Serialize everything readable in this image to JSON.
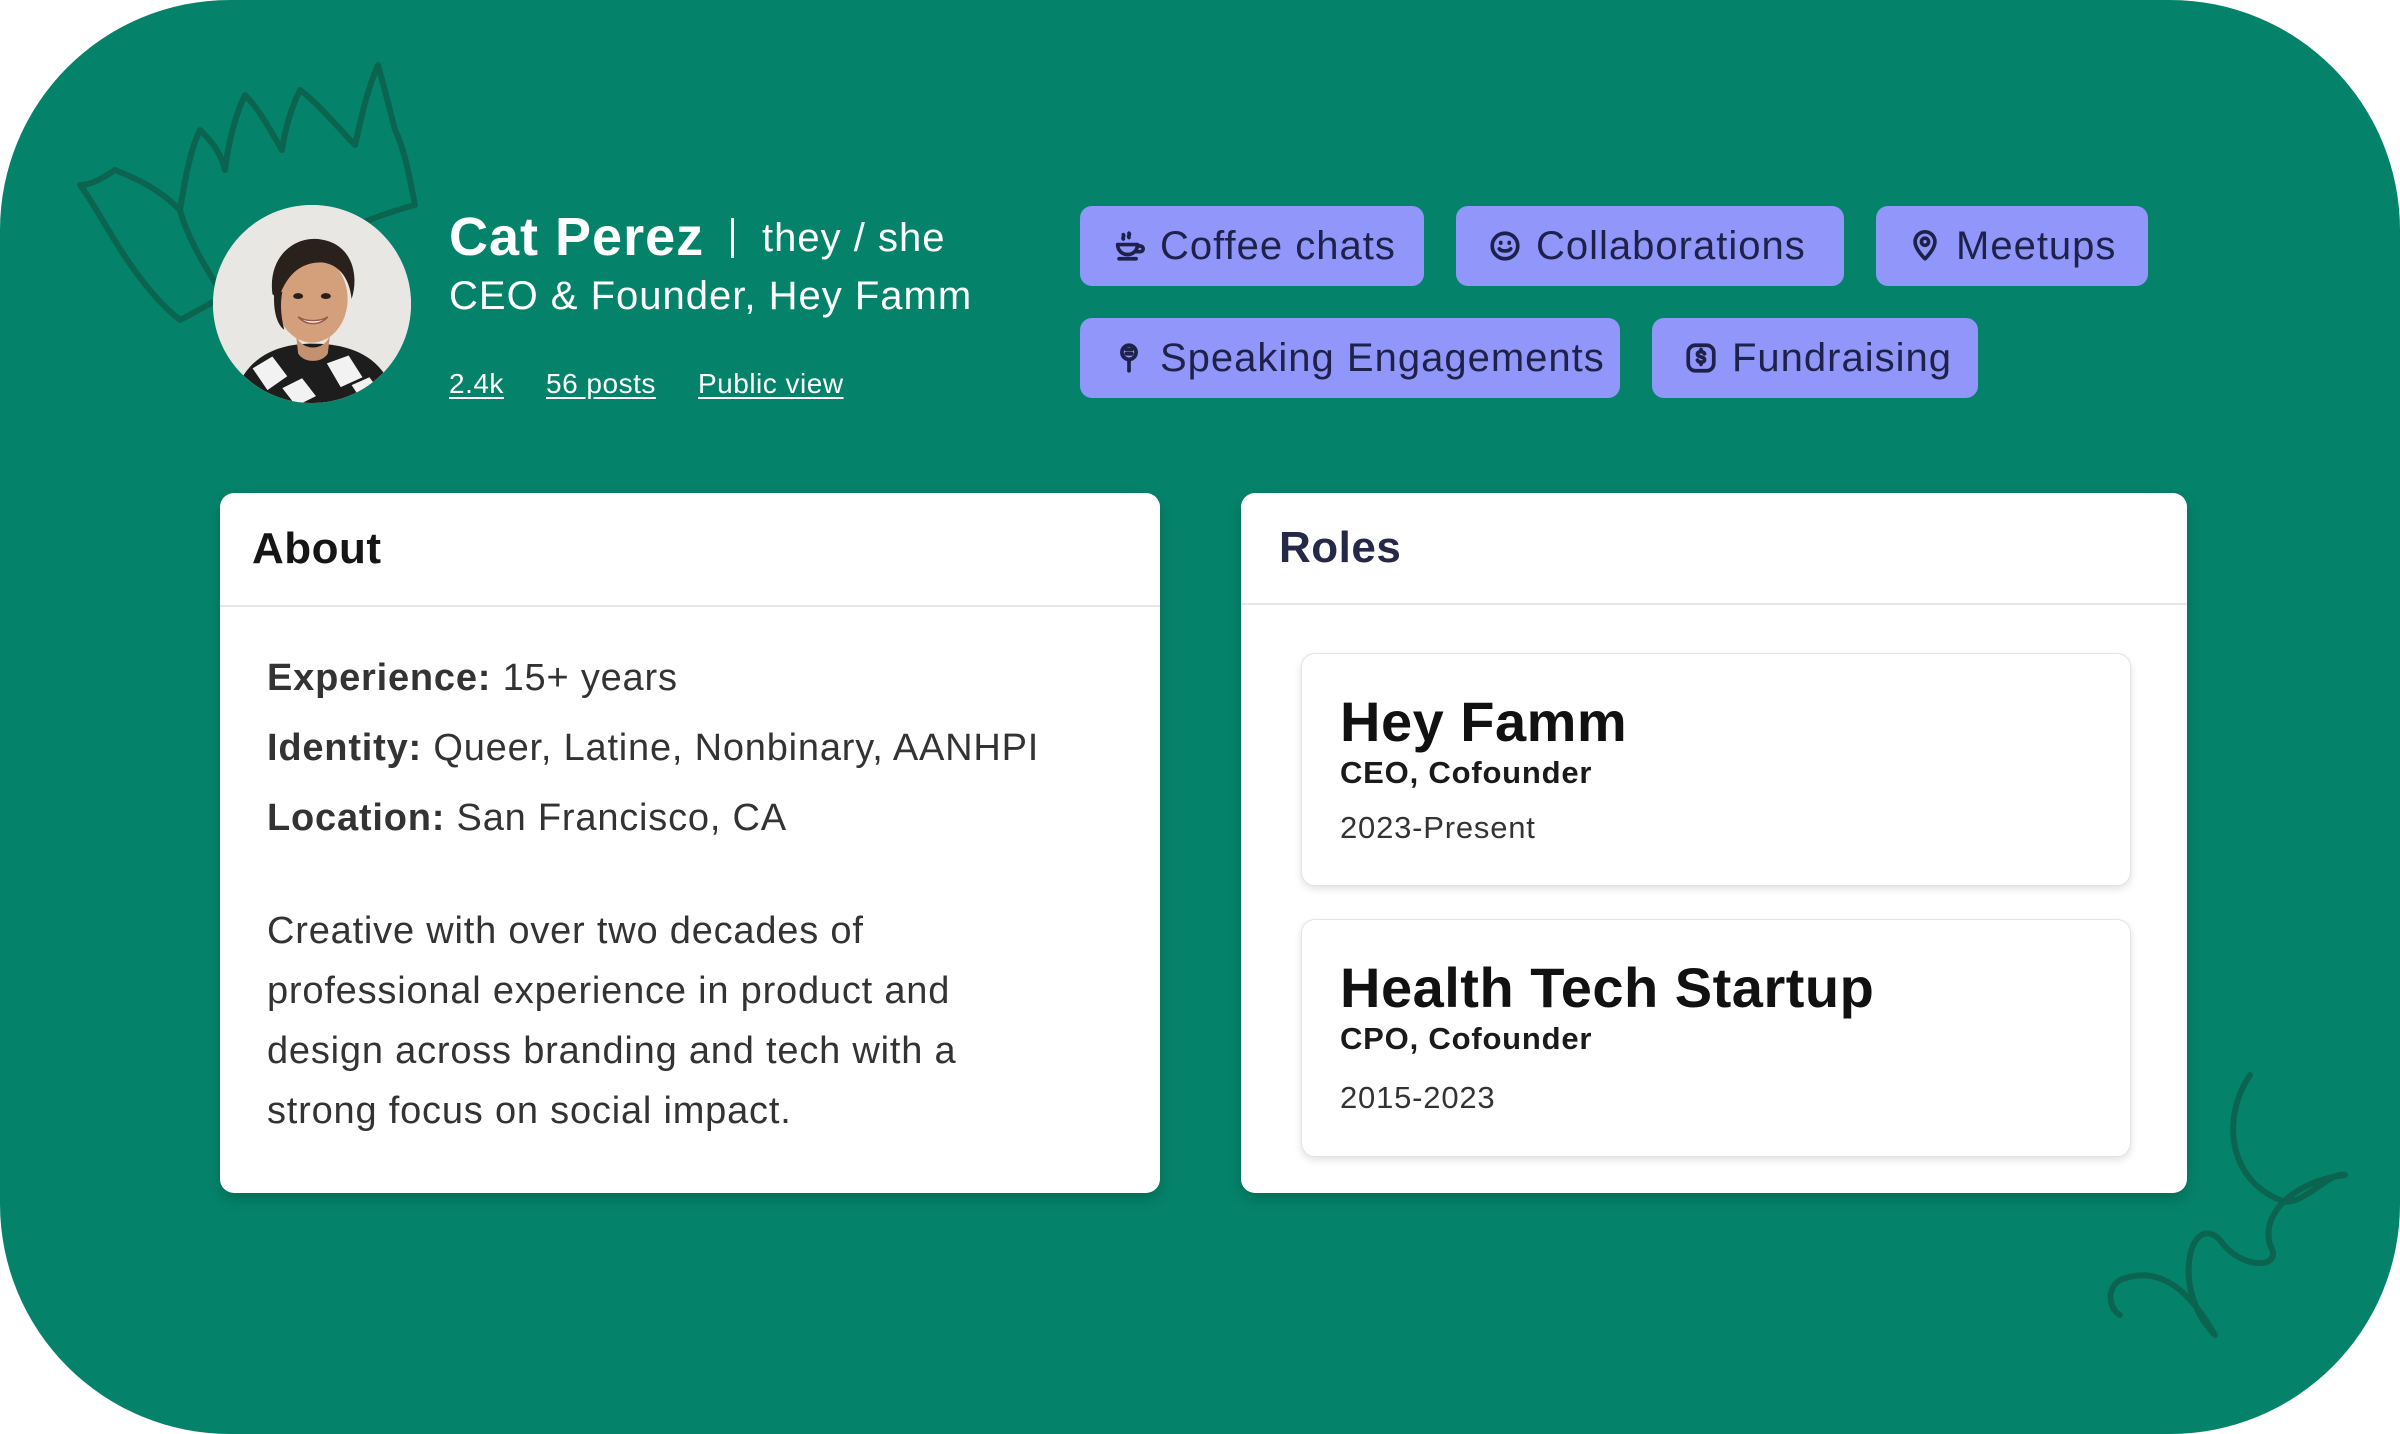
{
  "profile": {
    "name": "Cat Perez",
    "pronouns": "they / she",
    "headline": "CEO & Founder, Hey Famm",
    "stats": {
      "followers": "2.4k",
      "posts": "56 posts",
      "public_view": "Public view"
    }
  },
  "tags": [
    {
      "label": "Coffee chats",
      "icon": "coffee-cup-icon"
    },
    {
      "label": "Collaborations",
      "icon": "smiley-icon"
    },
    {
      "label": "Meetups",
      "icon": "map-pin-icon"
    },
    {
      "label": "Speaking Engagements",
      "icon": "microphone-icon"
    },
    {
      "label": "Fundraising",
      "icon": "dollar-icon"
    }
  ],
  "about": {
    "heading": "About",
    "facts": [
      {
        "label": "Experience:",
        "value": "15+ years"
      },
      {
        "label": "Identity:",
        "value": "Queer, Latine, Nonbinary, AANHPI"
      },
      {
        "label": "Location:",
        "value": "San Francisco, CA"
      }
    ],
    "bio": "Creative with over two decades of professional experience in product and design across branding and tech with a strong focus on social impact."
  },
  "roles": {
    "heading": "Roles",
    "items": [
      {
        "company": "Hey Famm",
        "title": "CEO, Cofounder",
        "dates": "2023-Present"
      },
      {
        "company": "Health Tech Startup",
        "title": "CPO, Cofounder",
        "dates": "2015-2023"
      }
    ]
  },
  "colors": {
    "background": "#05836a",
    "tag": "#9196fa",
    "doodle": "#0b6450"
  }
}
